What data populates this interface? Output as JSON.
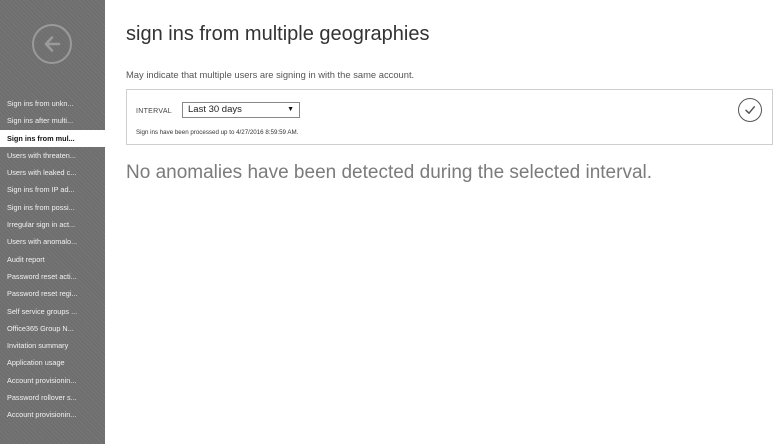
{
  "sidebar": {
    "back_icon": "arrow-left-circle-icon",
    "items": [
      {
        "label": "Sign ins from unkn..."
      },
      {
        "label": "Sign ins after multi..."
      },
      {
        "label": "Sign ins from mul...",
        "active": true
      },
      {
        "label": "Users with threaten..."
      },
      {
        "label": "Users with leaked c..."
      },
      {
        "label": "Sign ins from IP ad..."
      },
      {
        "label": "Sign ins from possi..."
      },
      {
        "label": "Irregular sign in act..."
      },
      {
        "label": "Users with anomalo..."
      },
      {
        "label": "Audit report"
      },
      {
        "label": "Password reset acti..."
      },
      {
        "label": "Password reset regi..."
      },
      {
        "label": "Self service groups ..."
      },
      {
        "label": "Office365 Group N..."
      },
      {
        "label": "Invitation summary"
      },
      {
        "label": "Application usage"
      },
      {
        "label": "Account provisionin..."
      },
      {
        "label": "Password rollover s..."
      },
      {
        "label": "Account provisionin..."
      }
    ]
  },
  "main": {
    "title": "sign ins from multiple geographies",
    "subtitle": "May indicate that multiple users are signing in with the same account.",
    "interval": {
      "label": "INTERVAL",
      "selected": "Last 30 days",
      "processed_note": "Sign ins have been processed up to 4/27/2016 8:59:59 AM.",
      "confirm_icon": "checkmark-circle-icon"
    },
    "empty_message": "No anomalies have been detected during the selected interval."
  },
  "colors": {
    "sidebar_bg": "#6f6f6f",
    "sidebar_text": "#f2f2f2",
    "active_item_bg": "#ffffff",
    "message_text": "#7b7b7b"
  }
}
